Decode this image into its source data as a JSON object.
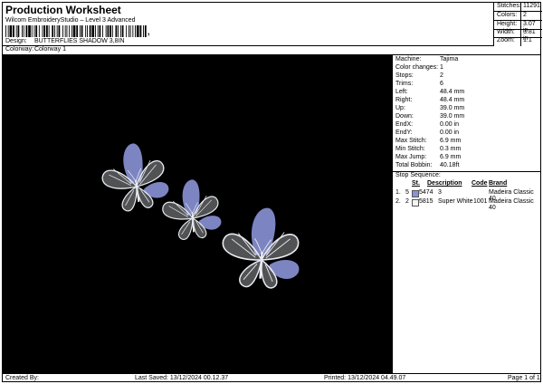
{
  "header": {
    "title": "Production Worksheet",
    "subtitle": "Wilcom EmbroideryStudio – Level 3 Advanced",
    "barcode_suffix": ",",
    "design_label": "Design:",
    "design_value": "BUTTERFLIES SHADOW 3,8IN",
    "colorway_label": "Colorway:",
    "colorway_value": "Colorway 1"
  },
  "stats": [
    {
      "label": "Stitches:",
      "value": "11291"
    },
    {
      "label": "Colors:",
      "value": "2"
    },
    {
      "label": "Height:",
      "value": "3.07 in"
    },
    {
      "label": "Width:",
      "value": "3.81 in"
    },
    {
      "label": "Zoom:",
      "value": "1:1"
    }
  ],
  "machine_info": [
    {
      "label": "Machine:",
      "value": "Tajima"
    },
    {
      "label": "Color changes:",
      "value": "1"
    },
    {
      "label": "Stops:",
      "value": "2"
    },
    {
      "label": "Trims:",
      "value": "6"
    },
    {
      "label": "Left:",
      "value": "48.4 mm"
    },
    {
      "label": "Right:",
      "value": "48.4 mm"
    },
    {
      "label": "Up:",
      "value": "39.0 mm"
    },
    {
      "label": "Down:",
      "value": "39.0 mm"
    },
    {
      "label": "EndX:",
      "value": "0.00 in"
    },
    {
      "label": "EndY:",
      "value": "0.00 in"
    },
    {
      "label": "Max Stitch:",
      "value": "6.9 mm"
    },
    {
      "label": "Min Stitch:",
      "value": "0.3 mm"
    },
    {
      "label": "Max Jump:",
      "value": "6.9 mm"
    },
    {
      "label": "Total Bobbin:",
      "value": "40.18ft"
    }
  ],
  "stop_sequence": {
    "title": "Stop Sequence:",
    "columns": {
      "st": "St.",
      "description": "Description",
      "code": "Code",
      "brand": "Brand"
    },
    "rows": [
      {
        "num": "1.",
        "st": "5",
        "swatch_code": "5474",
        "description": "3",
        "code": "",
        "brand": "Madeira Classic 40",
        "color": "#8a93d6"
      },
      {
        "num": "2.",
        "st": "2",
        "swatch_code": "5815",
        "description": "Super White",
        "code": "1001",
        "brand": "Madeira Classic 40",
        "color": "#f4f4f4"
      }
    ]
  },
  "colors": {
    "thread1": "#8a93d6",
    "thread2": "#e8eaf0",
    "background": "#000000"
  },
  "footer": {
    "created_by": "Created By:",
    "last_saved": "Last Saved: 13/12/2024 00.12.37",
    "printed": "Printed: 13/12/2024 04.49.07",
    "page": "Page 1 of 1"
  }
}
